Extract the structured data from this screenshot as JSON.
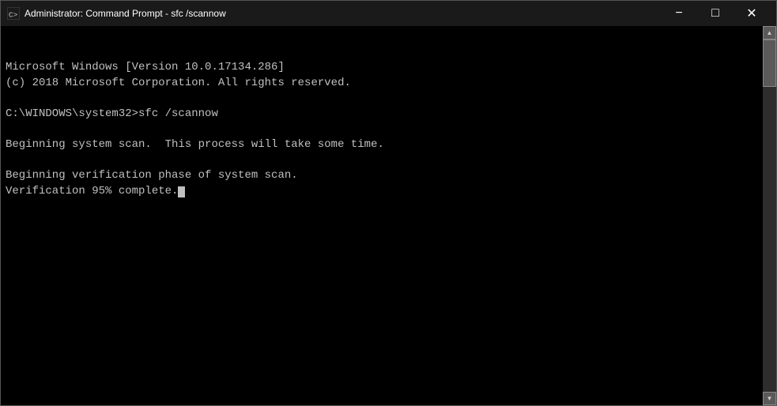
{
  "titleBar": {
    "icon": "cmd-icon",
    "title": "Administrator: Command Prompt - sfc /scannow",
    "minimizeLabel": "−",
    "maximizeLabel": "□",
    "closeLabel": "✕"
  },
  "terminal": {
    "lines": [
      "Microsoft Windows [Version 10.0.17134.286]",
      "(c) 2018 Microsoft Corporation. All rights reserved.",
      "",
      "C:\\WINDOWS\\system32>sfc /scannow",
      "",
      "Beginning system scan.  This process will take some time.",
      "",
      "Beginning verification phase of system scan.",
      "Verification 95% complete."
    ]
  }
}
